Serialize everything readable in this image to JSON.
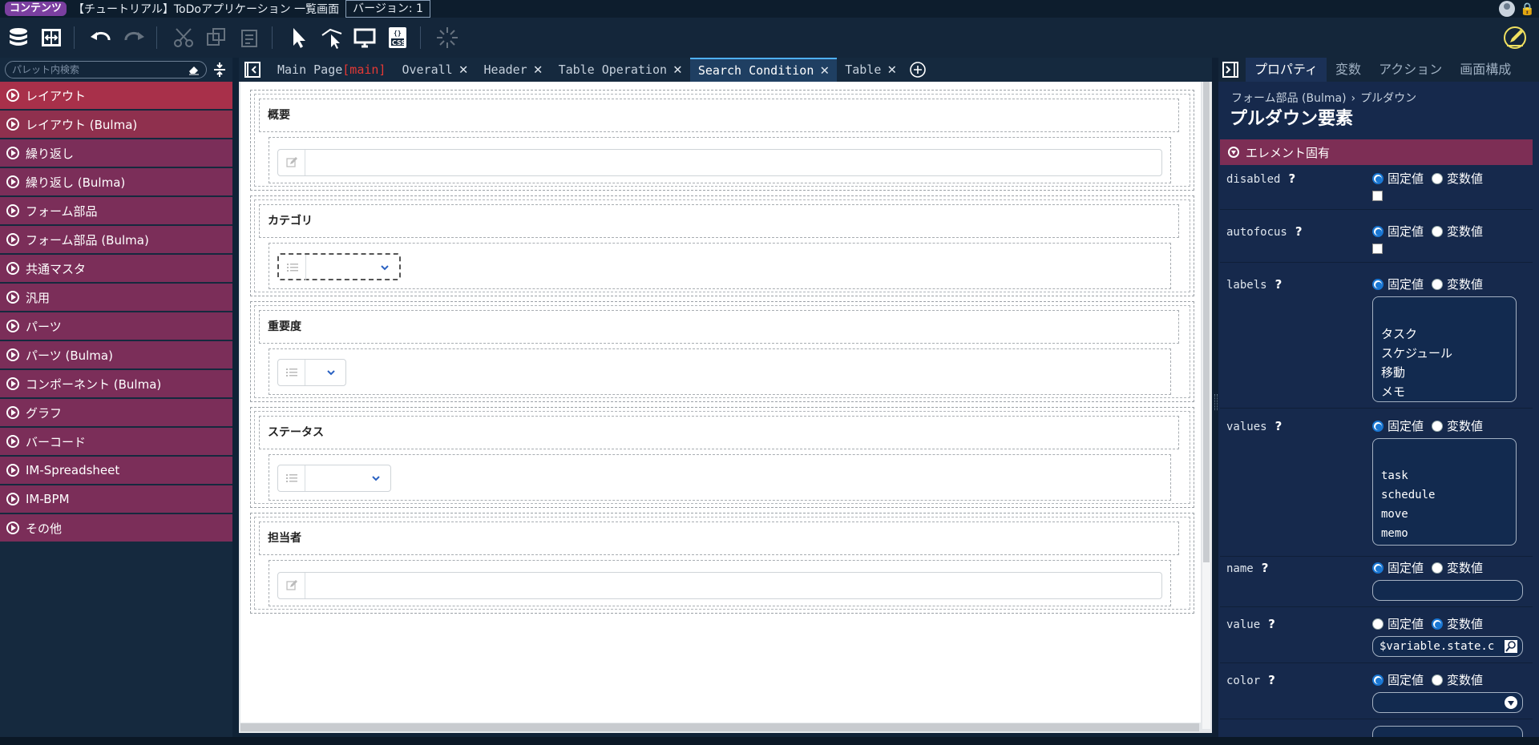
{
  "titlebar": {
    "badge": "コンテンツ",
    "title": "【チュートリアル】ToDoアプリケーション 一覧画面",
    "version": "バージョン: 1"
  },
  "palette": {
    "search_placeholder": "パレット内検索",
    "items": [
      {
        "label": "レイアウト"
      },
      {
        "label": "レイアウト (Bulma)"
      },
      {
        "label": "繰り返し"
      },
      {
        "label": "繰り返し (Bulma)"
      },
      {
        "label": "フォーム部品"
      },
      {
        "label": "フォーム部品 (Bulma)"
      },
      {
        "label": "共通マスタ"
      },
      {
        "label": "汎用"
      },
      {
        "label": "パーツ"
      },
      {
        "label": "パーツ (Bulma)"
      },
      {
        "label": "コンポーネント (Bulma)"
      },
      {
        "label": "グラフ"
      },
      {
        "label": "バーコード"
      },
      {
        "label": "IM-Spreadsheet"
      },
      {
        "label": "IM-BPM"
      },
      {
        "label": "その他"
      }
    ]
  },
  "tabs": [
    {
      "label": "Main Page",
      "suffix": "[main]",
      "closable": false,
      "active": false
    },
    {
      "label": "Overall",
      "closable": true,
      "active": false
    },
    {
      "label": "Header",
      "closable": true,
      "active": false
    },
    {
      "label": "Table Operation",
      "closable": true,
      "active": false
    },
    {
      "label": "Search Condition",
      "closable": true,
      "active": true
    },
    {
      "label": "Table",
      "closable": true,
      "active": false
    }
  ],
  "tab_close_glyph": "✕",
  "canvas": {
    "sections": [
      {
        "label": "概要",
        "kind": "input"
      },
      {
        "label": "カテゴリ",
        "kind": "select-focus"
      },
      {
        "label": "重要度",
        "kind": "select-small"
      },
      {
        "label": "ステータス",
        "kind": "select-medium"
      },
      {
        "label": "担当者",
        "kind": "input"
      }
    ]
  },
  "props": {
    "tabs": [
      "プロパティ",
      "変数",
      "アクション",
      "画面構成"
    ],
    "breadcrumb": [
      "フォーム部品 (Bulma)",
      "プルダウン"
    ],
    "breadcrumb_sep": "›",
    "title": "プルダウン要素",
    "section": "エレメント固有",
    "help_mark": "?",
    "radio_fixed": "固定値",
    "radio_variable": "変数値",
    "rows": {
      "disabled": {
        "name": "disabled",
        "mode": "fixed",
        "checked": false
      },
      "autofocus": {
        "name": "autofocus",
        "mode": "fixed",
        "checked": false
      },
      "labels": {
        "name": "labels",
        "mode": "fixed",
        "value": "\nタスク\nスケジュール\n移動\nメモ"
      },
      "values": {
        "name": "values",
        "mode": "fixed",
        "value": "\ntask\nschedule\nmove\nmemo"
      },
      "name": {
        "name": "name",
        "mode": "fixed",
        "value": ""
      },
      "value": {
        "name": "value",
        "mode": "variable",
        "value": "$variable.state.c"
      },
      "color": {
        "name": "color",
        "mode": "fixed",
        "value": ""
      }
    }
  },
  "colors": {
    "palette_item": "#7b2e59",
    "palette_first": "#a8304a",
    "accent_tab": "#4fb0ff",
    "panel_bg": "#16294c"
  }
}
